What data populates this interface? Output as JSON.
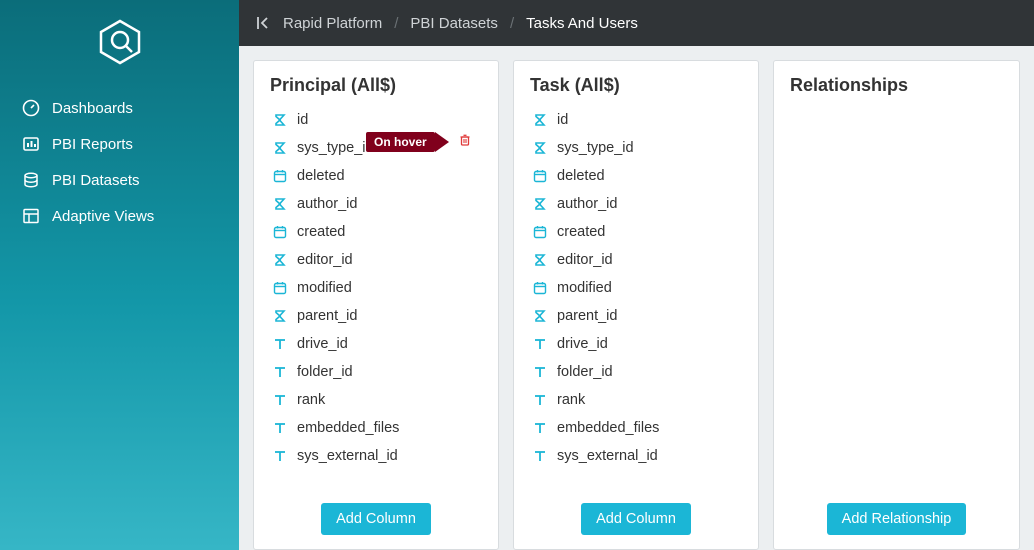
{
  "breadcrumb": {
    "root": "Rapid Platform",
    "mid": "PBI Datasets",
    "current": "Tasks And Users"
  },
  "sidebar": {
    "items": [
      {
        "label": "Dashboards"
      },
      {
        "label": "PBI Reports"
      },
      {
        "label": "PBI Datasets"
      },
      {
        "label": "Adaptive Views"
      }
    ]
  },
  "panels": {
    "principal": {
      "title": "Principal (All$)",
      "add_label": "Add Column",
      "fields": [
        {
          "icon": "sum",
          "name": "id"
        },
        {
          "icon": "sum",
          "name": "sys_type_id",
          "hover": true
        },
        {
          "icon": "date",
          "name": "deleted"
        },
        {
          "icon": "sum",
          "name": "author_id"
        },
        {
          "icon": "date",
          "name": "created"
        },
        {
          "icon": "sum",
          "name": "editor_id"
        },
        {
          "icon": "date",
          "name": "modified"
        },
        {
          "icon": "sum",
          "name": "parent_id"
        },
        {
          "icon": "text",
          "name": "drive_id"
        },
        {
          "icon": "text",
          "name": "folder_id"
        },
        {
          "icon": "text",
          "name": "rank"
        },
        {
          "icon": "text",
          "name": "embedded_files"
        },
        {
          "icon": "text",
          "name": "sys_external_id"
        }
      ]
    },
    "task": {
      "title": "Task (All$)",
      "add_label": "Add Column",
      "fields": [
        {
          "icon": "sum",
          "name": "id"
        },
        {
          "icon": "sum",
          "name": "sys_type_id"
        },
        {
          "icon": "date",
          "name": "deleted"
        },
        {
          "icon": "sum",
          "name": "author_id"
        },
        {
          "icon": "date",
          "name": "created"
        },
        {
          "icon": "sum",
          "name": "editor_id"
        },
        {
          "icon": "date",
          "name": "modified"
        },
        {
          "icon": "sum",
          "name": "parent_id"
        },
        {
          "icon": "text",
          "name": "drive_id"
        },
        {
          "icon": "text",
          "name": "folder_id"
        },
        {
          "icon": "text",
          "name": "rank"
        },
        {
          "icon": "text",
          "name": "embedded_files"
        },
        {
          "icon": "text",
          "name": "sys_external_id"
        }
      ]
    },
    "relationships": {
      "title": "Relationships",
      "add_label": "Add Relationship"
    }
  },
  "hover_text": "On hover"
}
